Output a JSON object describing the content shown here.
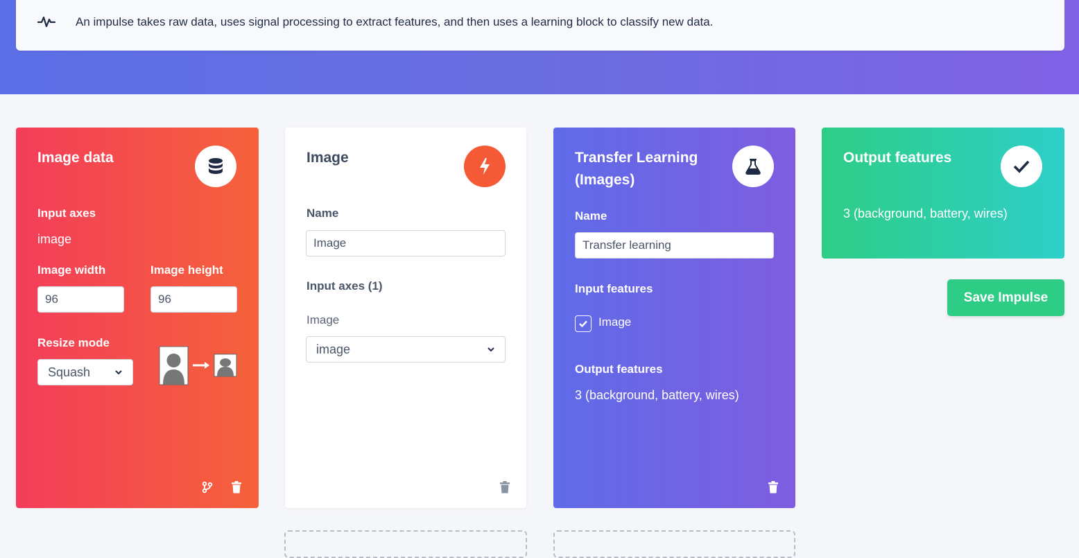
{
  "info": {
    "text": "An impulse takes raw data, uses signal processing to extract features, and then uses a learning block to classify new data."
  },
  "input_block": {
    "title": "Image data",
    "input_axes_label": "Input axes",
    "input_axes_value": "image",
    "width_label": "Image width",
    "width_value": "96",
    "height_label": "Image height",
    "height_value": "96",
    "resize_label": "Resize mode",
    "resize_value": "Squash"
  },
  "processing_block": {
    "title": "Image",
    "name_label": "Name",
    "name_value": "Image",
    "input_axes_label": "Input axes (1)",
    "image_label": "Image",
    "image_select_value": "image"
  },
  "learning_block": {
    "title": "Transfer Learning (Images)",
    "name_label": "Name",
    "name_value": "Transfer learning",
    "input_features_label": "Input features",
    "input_feature_item": "Image",
    "input_feature_checked": true,
    "output_features_label": "Output features",
    "output_features_value": "3 (background, battery, wires)"
  },
  "output_block": {
    "title": "Output features",
    "value": "3 (background, battery, wires)"
  },
  "save_button": "Save Impulse",
  "colors": {
    "input_grad": [
      "#f43d5a",
      "#f5623a"
    ],
    "learning_grad": [
      "#5f6be8",
      "#7e5de0"
    ],
    "output_grad": [
      "#2ecd86",
      "#2ecfc9"
    ],
    "processing_badge": "#f55a36"
  }
}
